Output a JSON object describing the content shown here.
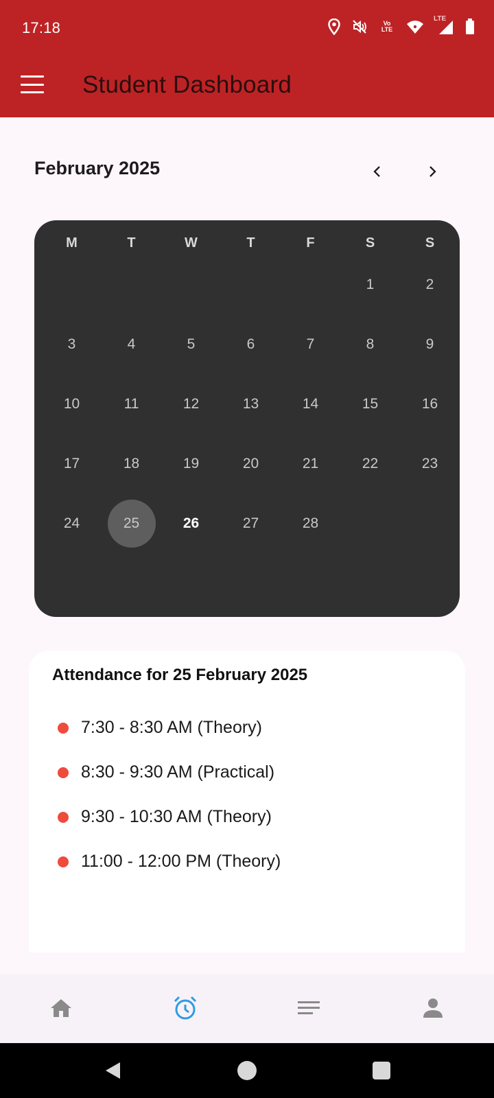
{
  "status_bar": {
    "time": "17:18",
    "volte_label": "Vo LTE",
    "lte_label": "LTE",
    "icons": [
      "location-icon",
      "mute-vibrate-icon",
      "volte-icon",
      "wifi-icon",
      "signal-icon",
      "battery-icon"
    ]
  },
  "app_bar": {
    "title": "Student Dashboard",
    "menu_icon": "hamburger-menu-icon",
    "background_color": "#BD2325"
  },
  "calendar": {
    "month_label": "February 2025",
    "prev_icon": "chevron-left-icon",
    "next_icon": "chevron-right-icon",
    "weekdays": [
      "M",
      "T",
      "W",
      "T",
      "F",
      "S",
      "S"
    ],
    "leading_empty_days": 5,
    "days": [
      "1",
      "2",
      "3",
      "4",
      "5",
      "6",
      "7",
      "8",
      "9",
      "10",
      "11",
      "12",
      "13",
      "14",
      "15",
      "16",
      "17",
      "18",
      "19",
      "20",
      "21",
      "22",
      "23",
      "24",
      "25",
      "26",
      "27",
      "28"
    ],
    "selected_day": "25",
    "today": "26",
    "background_color": "#303030"
  },
  "attendance": {
    "title": "Attendance for 25 February 2025",
    "sessions": [
      "7:30 - 8:30 AM (Theory)",
      "8:30 - 9:30 AM (Practical)",
      "9:30 - 10:30 AM (Theory)",
      "11:00 - 12:00 PM (Theory)"
    ],
    "dot_color": "#EE4B3D"
  },
  "bottom_nav": {
    "items": [
      {
        "name": "home",
        "icon": "home-icon",
        "active": false
      },
      {
        "name": "attendance",
        "icon": "alarm-clock-icon",
        "active": true
      },
      {
        "name": "notes",
        "icon": "list-lines-icon",
        "active": false
      },
      {
        "name": "profile",
        "icon": "person-icon",
        "active": false
      }
    ],
    "active_color": "#2E9AE6",
    "inactive_color": "#8A8A8A"
  },
  "system_nav": {
    "icons": [
      "back-icon",
      "home-circle-icon",
      "recents-icon"
    ]
  }
}
